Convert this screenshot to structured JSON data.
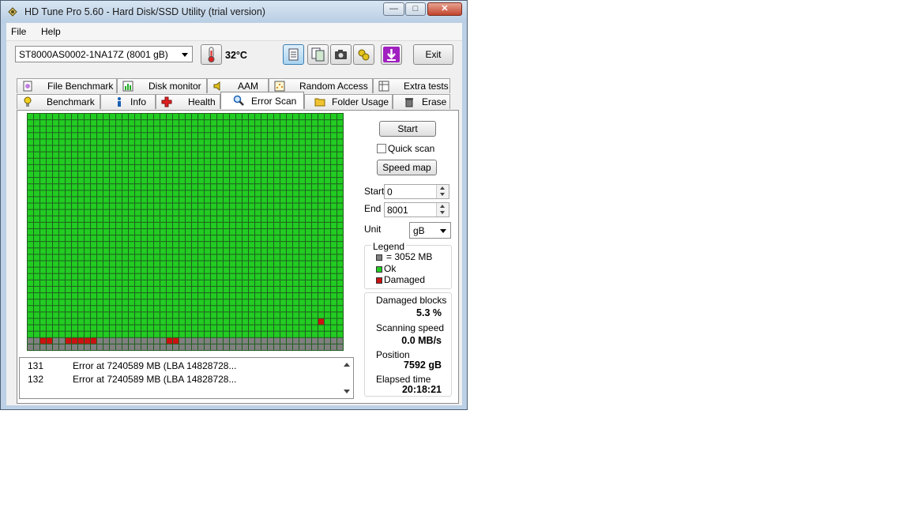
{
  "window": {
    "title": "HD Tune Pro 5.60 - Hard Disk/SSD Utility (trial version)"
  },
  "menu": {
    "file": "File",
    "help": "Help"
  },
  "toolbar": {
    "drive": "ST8000AS0002-1NA17Z (8001 gB)",
    "temperature": "32°C",
    "exit_label": "Exit"
  },
  "tabs_top": [
    "File Benchmark",
    "Disk monitor",
    "AAM",
    "Random Access",
    "Extra tests"
  ],
  "tabs_bottom": [
    "Benchmark",
    "Info",
    "Health",
    "Error Scan",
    "Folder Usage",
    "Erase"
  ],
  "active_tab": "Error Scan",
  "scan": {
    "start_label": "Start",
    "quick_scan_label": "Quick scan",
    "quick_scan_checked": false,
    "speed_map_label": "Speed map",
    "start_field_label": "Start",
    "start_value": "0",
    "end_field_label": "End",
    "end_value": "8001",
    "unit_label": "Unit",
    "unit_value": "gB"
  },
  "legend": {
    "title": "Legend",
    "block_size": "= 3052 MB",
    "ok": "Ok",
    "damaged": "Damaged",
    "colors": {
      "pending": "#808080",
      "ok": "#22cc22",
      "damaged": "#cc1111"
    }
  },
  "stats": {
    "damaged_blocks_label": "Damaged blocks",
    "damaged_blocks": "5.3 %",
    "speed_label": "Scanning speed",
    "speed": "0.0 MB/s",
    "position_label": "Position",
    "position": "7592 gB",
    "elapsed_label": "Elapsed time",
    "elapsed": "20:18:21"
  },
  "log": [
    {
      "index": "131",
      "message": "Error at 7240589 MB (LBA 14828728..."
    },
    {
      "index": "132",
      "message": "Error at 7240589 MB (LBA 14828728..."
    }
  ],
  "block_map": {
    "columns": 50,
    "rows": 37,
    "ok_rows": 35,
    "damaged_cells": [
      {
        "row": 32,
        "col": 46
      },
      {
        "row": 35,
        "col": 2
      },
      {
        "row": 35,
        "col": 3
      },
      {
        "row": 35,
        "col": 6
      },
      {
        "row": 35,
        "col": 7
      },
      {
        "row": 35,
        "col": 8
      },
      {
        "row": 35,
        "col": 9
      },
      {
        "row": 35,
        "col": 10
      },
      {
        "row": 35,
        "col": 22
      },
      {
        "row": 35,
        "col": 23
      }
    ]
  }
}
